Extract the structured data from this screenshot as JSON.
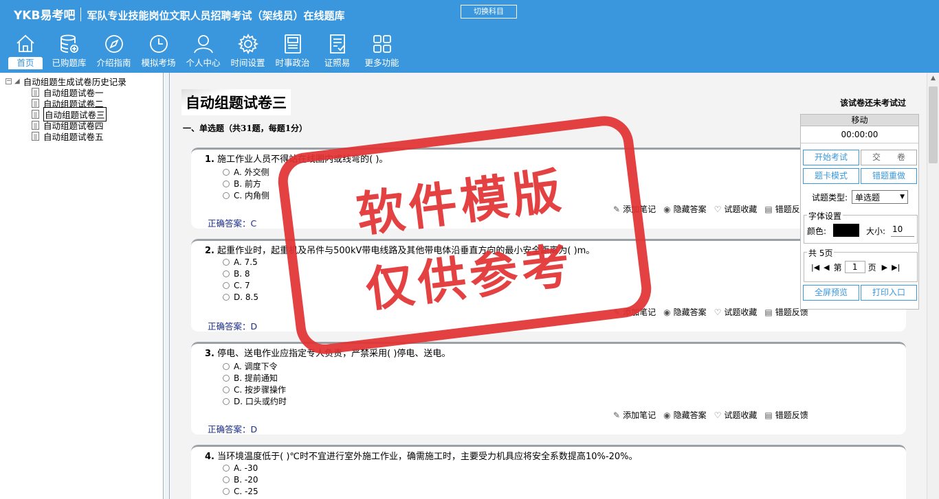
{
  "header": {
    "logo": "YKB易考吧",
    "title": "军队专业技能岗位文职人员招聘考试（架线员）在线题库",
    "switch_subject": "切换科目"
  },
  "nav": [
    {
      "label": "首页",
      "icon": "home-icon"
    },
    {
      "label": "已购题库",
      "icon": "database-icon"
    },
    {
      "label": "介绍指南",
      "icon": "compass-icon"
    },
    {
      "label": "模拟考场",
      "icon": "clock-icon"
    },
    {
      "label": "个人中心",
      "icon": "user-icon"
    },
    {
      "label": "时间设置",
      "icon": "gear-icon"
    },
    {
      "label": "时事政治",
      "icon": "newspaper-icon"
    },
    {
      "label": "证照易",
      "icon": "certificate-icon"
    },
    {
      "label": "更多功能",
      "icon": "grid-icon"
    }
  ],
  "tree": {
    "root": "自动组题生成试卷历史记录",
    "items": [
      "自动组题试卷一",
      "自动组题试卷二",
      "自动组题试卷三",
      "自动组题试卷四",
      "自动组题试卷五"
    ],
    "selected": "自动组题试卷三"
  },
  "paper": {
    "title": "自动组题试卷三",
    "status": "该试卷还未考试过",
    "section": "一、单选题（共31题，每题1分）"
  },
  "questions": [
    {
      "num": "1.",
      "stem": "施工作业人员不得站在线圈内或线弯的( )。",
      "options": [
        "A. 外交侧",
        "B. 前方",
        "C. 内角侧"
      ],
      "answer": "正确答案：C"
    },
    {
      "num": "2.",
      "stem": "起重作业时，起重机及吊件与500kV带电线路及其他带电体沿垂直方向的最小安全距离为( )m。",
      "options": [
        "A. 7.5",
        "B. 8",
        "C. 7",
        "D. 8.5"
      ],
      "answer": "正确答案：D"
    },
    {
      "num": "3.",
      "stem": "停电、送电作业应指定专人负责，严禁采用( )停电、送电。",
      "options": [
        "A. 调度下令",
        "B. 提前通知",
        "C. 按步骤操作",
        "D. 口头或约时"
      ],
      "answer": "正确答案：D"
    },
    {
      "num": "4.",
      "stem": "当环境温度低于( )℃时不宜进行室外施工作业，确需施工时，主要受力机具应将安全系数提高10%-20%。",
      "options": [
        "A. -30",
        "B. -20",
        "C. -25"
      ],
      "answer": ""
    }
  ],
  "actions": {
    "note": "添加笔记",
    "hide": "隐藏答案",
    "fav": "试题收藏",
    "report": "错题反馈"
  },
  "panel": {
    "move": "移动",
    "timer": "00:00:00",
    "start": "开始考试",
    "submit": "交　　卷",
    "card_mode": "题卡模式",
    "redo": "错题重做",
    "qtype_label": "试题类型:",
    "qtype_value": "单选题",
    "font_legend": "字体设置",
    "color_label": "颜色:",
    "size_label": "大小:",
    "size_value": "10",
    "pages_legend": "共 5页",
    "page_prefix": "第",
    "page_value": "1",
    "page_suffix": "页",
    "fullscreen": "全屏预览",
    "print": "打印入口"
  },
  "watermark": {
    "line1": "软件模版",
    "line2": "仅供参考"
  },
  "colors": {
    "header_bg": "#3a97dd",
    "answer": "#1a2d8a",
    "stamp": "#e23232"
  }
}
